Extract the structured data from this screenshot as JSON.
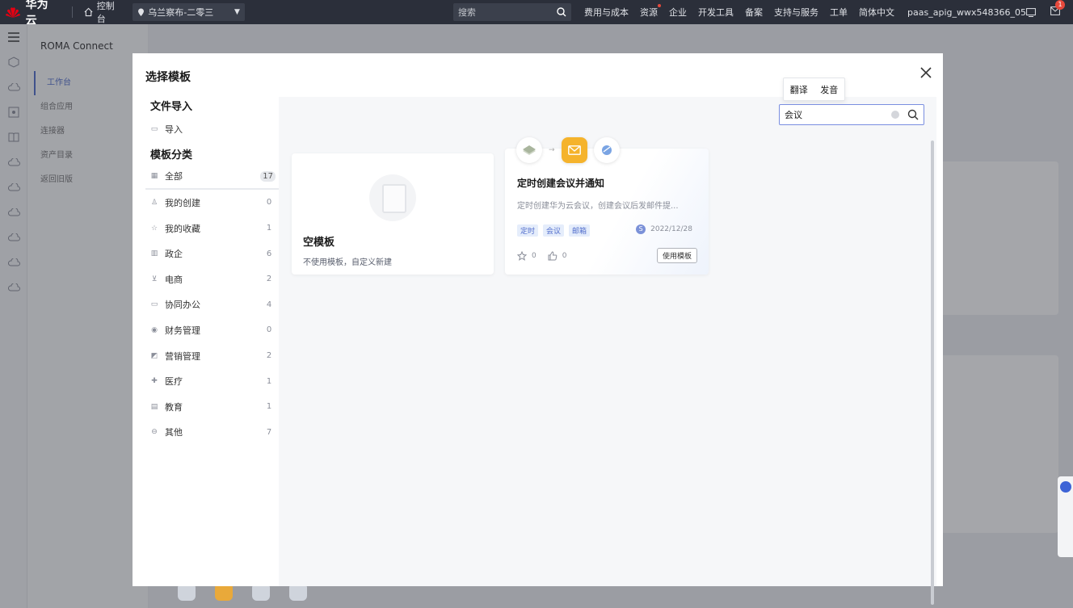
{
  "topbar": {
    "brand": "华为云",
    "console": "控制台",
    "region": "乌兰察布-二零三",
    "search_placeholder": "搜索",
    "links": [
      "费用与成本",
      "资源",
      "企业",
      "开发工具",
      "备案",
      "支持与服务",
      "工单",
      "简体中文"
    ],
    "user": "paas_apig_wwx548366_05",
    "notification_count": "1"
  },
  "sidebar": {
    "title": "ROMA Connect",
    "items": [
      "工作台",
      "组合应用",
      "连接器",
      "资产目录",
      "返回旧版"
    ]
  },
  "modal": {
    "title": "选择模板",
    "file_import_heading": "文件导入",
    "import_label": "导入",
    "category_heading": "模板分类",
    "categories": [
      {
        "label": "全部",
        "count": "17",
        "icon": "grid-icon"
      },
      {
        "label": "我的创建",
        "count": "0",
        "icon": "user-icon"
      },
      {
        "label": "我的收藏",
        "count": "1",
        "icon": "star-icon"
      },
      {
        "label": "政企",
        "count": "6",
        "icon": "building-icon"
      },
      {
        "label": "电商",
        "count": "2",
        "icon": "cart-icon"
      },
      {
        "label": "协同办公",
        "count": "4",
        "icon": "folder-icon"
      },
      {
        "label": "财务管理",
        "count": "0",
        "icon": "finance-icon"
      },
      {
        "label": "营销管理",
        "count": "2",
        "icon": "marketing-icon"
      },
      {
        "label": "医疗",
        "count": "1",
        "icon": "medical-icon"
      },
      {
        "label": "教育",
        "count": "1",
        "icon": "education-icon"
      },
      {
        "label": "其他",
        "count": "7",
        "icon": "other-icon"
      }
    ],
    "tooltip": {
      "translate": "翻译",
      "pronounce": "发音"
    },
    "search_value": "会议",
    "empty_card": {
      "name": "空模板",
      "desc": "不使用模板，自定义新建"
    },
    "template_card": {
      "name": "定时创建会议并通知",
      "desc": "定时创建华为云会议，创建会议后发邮件提...",
      "tags": [
        "定时",
        "会议",
        "邮箱"
      ],
      "date": "2022/12/28",
      "favorites": "0",
      "likes": "0",
      "use_button": "使用模板"
    }
  },
  "colors": {
    "topbar": "#2b2f3a",
    "accent": "#526ecc",
    "mail": "#f5b32c"
  }
}
